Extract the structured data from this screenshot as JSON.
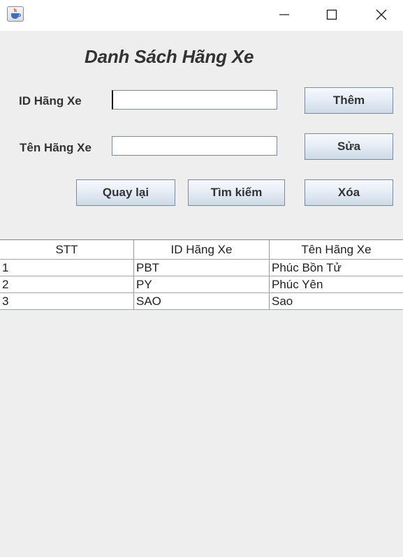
{
  "window": {
    "icon": "java-coffee-icon",
    "controls": [
      "minimize-icon",
      "maximize-icon",
      "close-icon"
    ]
  },
  "form": {
    "title": "Danh Sách Hãng Xe",
    "id_label": "ID Hãng Xe",
    "id_value": "",
    "name_label": "Tên Hãng Xe",
    "name_value": ""
  },
  "buttons": {
    "add": "Thêm",
    "edit": "Sửa",
    "back": "Quay lại",
    "search": "Tìm kiếm",
    "delete": "Xóa"
  },
  "table": {
    "columns": [
      "STT",
      "ID Hãng Xe",
      "Tên Hãng Xe"
    ],
    "rows": [
      [
        "1",
        "PBT",
        "Phúc Bồn Tử"
      ],
      [
        "2",
        "PY",
        "Phúc Yên"
      ],
      [
        "3",
        "SAO",
        "Sao"
      ]
    ]
  }
}
